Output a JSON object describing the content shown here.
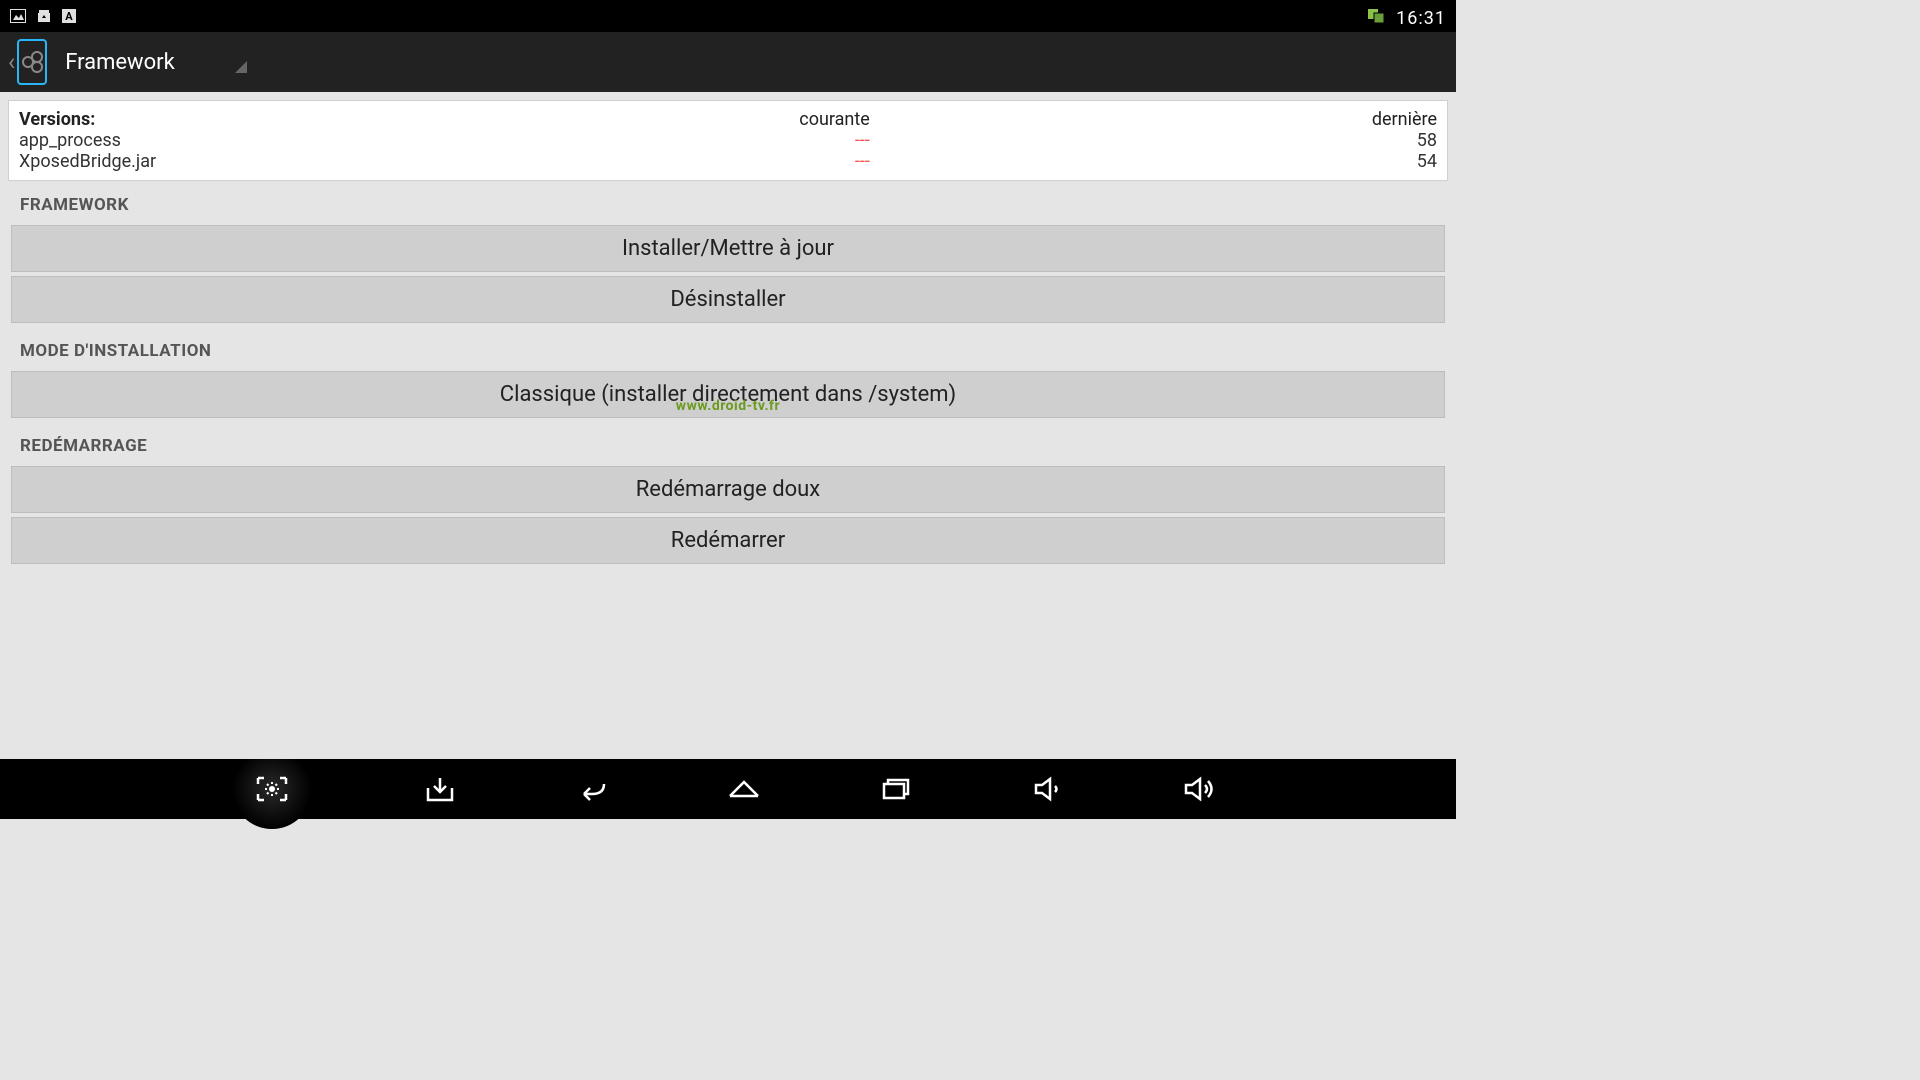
{
  "status_bar": {
    "time": "16:31"
  },
  "action_bar": {
    "title": "Framework"
  },
  "versions": {
    "label": "Versions:",
    "col_current": "courante",
    "col_latest": "dernière",
    "rows": [
      {
        "name": "app_process",
        "current": "---",
        "latest": "58"
      },
      {
        "name": "XposedBridge.jar",
        "current": "---",
        "latest": "54"
      }
    ]
  },
  "sections": {
    "framework": {
      "header": "FRAMEWORK",
      "install": "Installer/Mettre à jour",
      "uninstall": "Désinstaller"
    },
    "install_mode": {
      "header": "MODE D'INSTALLATION",
      "mode": "Classique (installer directement dans /system)"
    },
    "reboot": {
      "header": "REDÉMARRAGE",
      "soft": "Redémarrage doux",
      "hard": "Redémarrer"
    }
  },
  "watermark": "www.droid-tv.fr"
}
